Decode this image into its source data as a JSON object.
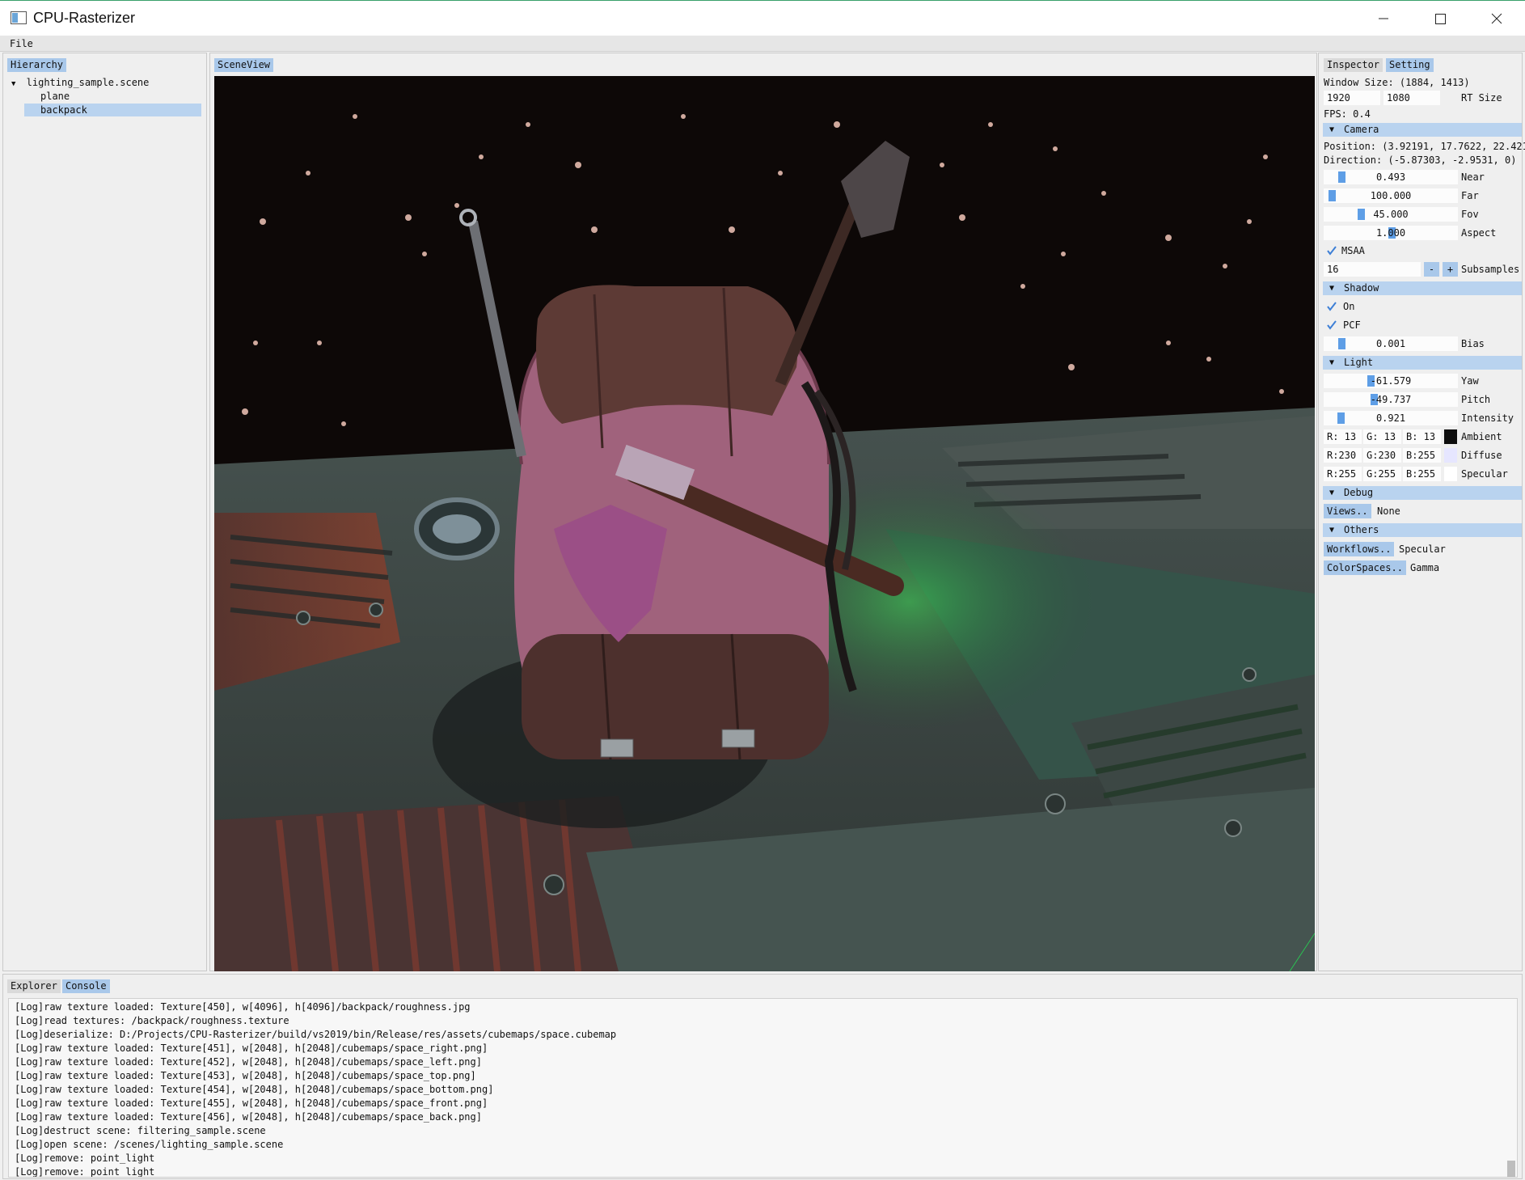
{
  "window": {
    "title": "CPU-Rasterizer",
    "minimize_icon": "minimize-icon",
    "maximize_icon": "maximize-icon",
    "close_icon": "close-icon"
  },
  "menu": {
    "file": "File"
  },
  "hierarchy": {
    "tab": "Hierarchy",
    "root": "lighting_sample.scene",
    "children": [
      "plane",
      "backpack"
    ],
    "selected": "backpack"
  },
  "scene_view": {
    "tab": "SceneView"
  },
  "inspector": {
    "tabs": [
      "Inspector",
      "Setting"
    ],
    "active_tab": "Setting",
    "window_size": "Window Size: (1884, 1413)",
    "rt_width": "1920",
    "rt_height": "1080",
    "rt_label": "RT Size",
    "fps": "FPS: 0.4",
    "camera": {
      "header": "Camera",
      "position": "Position: (3.92191, 17.7622, 22.421",
      "direction": "Direction: (-5.87303, -2.9531, 0)",
      "near": {
        "value": "0.493",
        "label": "Near",
        "fraction": 0.1
      },
      "far": {
        "value": "100.000",
        "label": "Far",
        "fraction": 0.02
      },
      "fov": {
        "value": "45.000",
        "label": "Fov",
        "fraction": 0.25
      },
      "aspect": {
        "value": "1.000",
        "label": "Aspect",
        "fraction": 0.5
      },
      "msaa": {
        "label": "MSAA",
        "checked": true
      },
      "subsamples": {
        "value": "16",
        "minus": "-",
        "plus": "+",
        "label": "Subsamples"
      }
    },
    "shadow": {
      "header": "Shadow",
      "on": {
        "label": "On",
        "checked": true
      },
      "pcf": {
        "label": "PCF",
        "checked": true
      },
      "bias": {
        "value": "0.001",
        "label": "Bias",
        "fraction": 0.1
      }
    },
    "light": {
      "header": "Light",
      "yaw": {
        "value": "-61.579",
        "label": "Yaw",
        "fraction": 0.33
      },
      "pitch": {
        "value": "-49.737",
        "label": "Pitch",
        "fraction": 0.36
      },
      "intensity": {
        "value": "0.921",
        "label": "Intensity",
        "fraction": 0.09
      },
      "ambient": {
        "r": "R: 13",
        "g": "G: 13",
        "b": "B: 13",
        "label": "Ambient",
        "color": "#0d0d0d"
      },
      "diffuse": {
        "r": "R:230",
        "g": "G:230",
        "b": "B:255",
        "label": "Diffuse",
        "color": "#e6e6ff"
      },
      "specular": {
        "r": "R:255",
        "g": "G:255",
        "b": "B:255",
        "label": "Specular",
        "color": "#ffffff"
      }
    },
    "debug": {
      "header": "Debug",
      "views_button": "Views..",
      "views_value": "None"
    },
    "others": {
      "header": "Others",
      "workflows_button": "Workflows..",
      "workflows_value": "Specular",
      "colorspaces_button": "ColorSpaces..",
      "colorspaces_value": "Gamma"
    }
  },
  "bottom": {
    "tabs": [
      "Explorer",
      "Console"
    ],
    "active_tab": "Console",
    "log": [
      "[Log]raw texture loaded: Texture[450], w[4096], h[4096]/backpack/roughness.jpg",
      "[Log]read textures: /backpack/roughness.texture",
      "[Log]deserialize: D:/Projects/CPU-Rasterizer/build/vs2019/bin/Release/res/assets/cubemaps/space.cubemap",
      "[Log]raw texture loaded: Texture[451], w[2048], h[2048]/cubemaps/space_right.png]",
      "[Log]raw texture loaded: Texture[452], w[2048], h[2048]/cubemaps/space_left.png]",
      "[Log]raw texture loaded: Texture[453], w[2048], h[2048]/cubemaps/space_top.png]",
      "[Log]raw texture loaded: Texture[454], w[2048], h[2048]/cubemaps/space_bottom.png]",
      "[Log]raw texture loaded: Texture[455], w[2048], h[2048]/cubemaps/space_front.png]",
      "[Log]raw texture loaded: Texture[456], w[2048], h[2048]/cubemaps/space_back.png]",
      "[Log]destruct scene: filtering_sample.scene",
      "[Log]open scene: /scenes/lighting_sample.scene",
      "[Log]remove: point_light",
      "[Log]remove: point_light"
    ]
  },
  "colors": {
    "accent": "#a9c8ea",
    "selection": "#b9d3ef",
    "slider_grab": "#5e9ee6",
    "check": "#3d7fd6"
  }
}
